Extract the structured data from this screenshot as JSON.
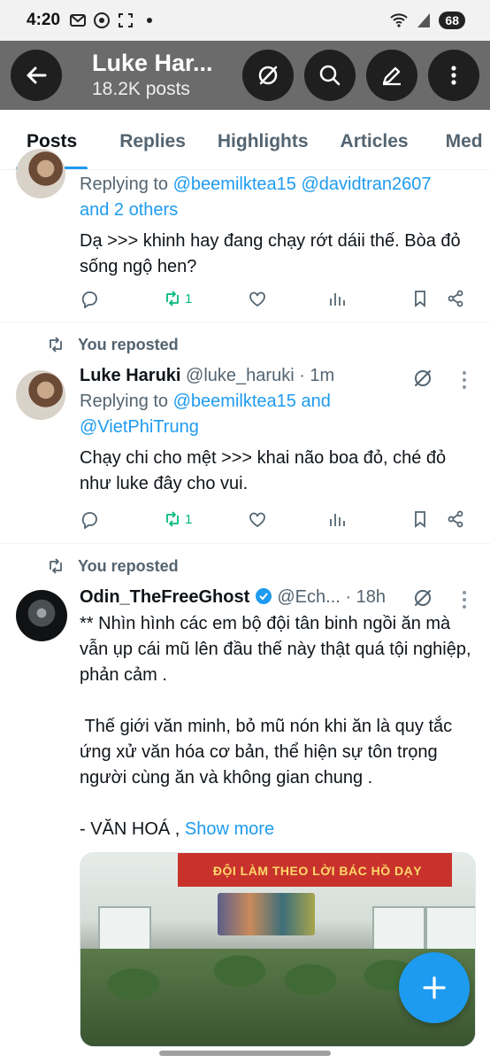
{
  "status_bar": {
    "time": "4:20",
    "battery": "68"
  },
  "header": {
    "title": "Luke Har...",
    "post_count": "18.2K posts"
  },
  "tabs": [
    {
      "label": "Posts",
      "active": true
    },
    {
      "label": "Replies"
    },
    {
      "label": "Highlights"
    },
    {
      "label": "Articles"
    },
    {
      "label": "Med"
    }
  ],
  "posts": [
    {
      "replying_prefix": "Replying to",
      "replying_line1": "@beemilktea15 @davidtran2607",
      "replying_line2": "and 2 others",
      "text": "Dạ >>> khinh hay đang chạy rớt dáii thế. Bòa đỏ sống ngộ hen?",
      "repost_count": "1"
    },
    {
      "repost_label": "You reposted",
      "name": "Luke Haruki",
      "handle": "@luke_haruki",
      "time": "· 1m",
      "replying_prefix": "Replying to",
      "replying_line1": "@beemilktea15 and",
      "replying_line2": "@VietPhiTrung",
      "text": "Chạy chi cho mệt >>> khai não boa đỏ, ché đỏ như luke đây cho vui.",
      "repost_count": "1"
    },
    {
      "repost_label": "You reposted",
      "name": "Odin_TheFreeGhost",
      "handle": "@Ech...",
      "time": "· 18h",
      "para1": "** Nhìn hình các em bộ đội tân binh ngồi ăn mà vẫn ụp cái mũ lên đầu thế này thật quá tội nghiệp, phản cảm .",
      "para2": " Thế giới văn minh, bỏ mũ nón khi ăn là quy tắc ứng xử văn hóa cơ bản, thể hiện sự tôn trọng người cùng ăn và không gian chung .",
      "para3": "- VĂN HOÁ ,",
      "show_more": "Show more",
      "image_banner": "ĐỘI LÀM THEO LỜI BÁC HỒ DẠY"
    }
  ],
  "colors": {
    "accent": "#1d9bf0",
    "repost_green": "#00ba7c",
    "secondary_text": "#536471"
  }
}
